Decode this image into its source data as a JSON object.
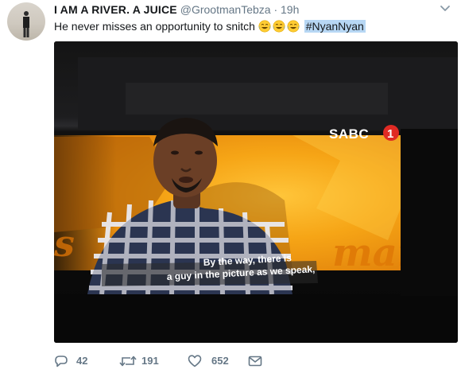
{
  "tweet": {
    "author_name": "I AM A RIVER. A JUICE",
    "handle": "@GrootmanTebza",
    "separator": "·",
    "time": "19h",
    "text": "He never misses an opportunity to snitch",
    "emoji": [
      "laughing-tears-emoji",
      "laughing-tears-emoji",
      "laughing-tears-emoji"
    ],
    "hashtag": "#NyanNyan"
  },
  "media": {
    "channel_logo": "SABC",
    "channel_number": "1",
    "show_title_fragment": "man",
    "subtitle_line1": "By the way, there is",
    "subtitle_line2": "a guy in the picture as we speak,"
  },
  "actions": {
    "reply_count": "42",
    "retweet_count": "191",
    "like_count": "652"
  },
  "colors": {
    "link": "#1da1f2",
    "meta": "#657786",
    "hashtag_highlight": "#b7d7f4",
    "studio_orange": "#f39a14"
  }
}
